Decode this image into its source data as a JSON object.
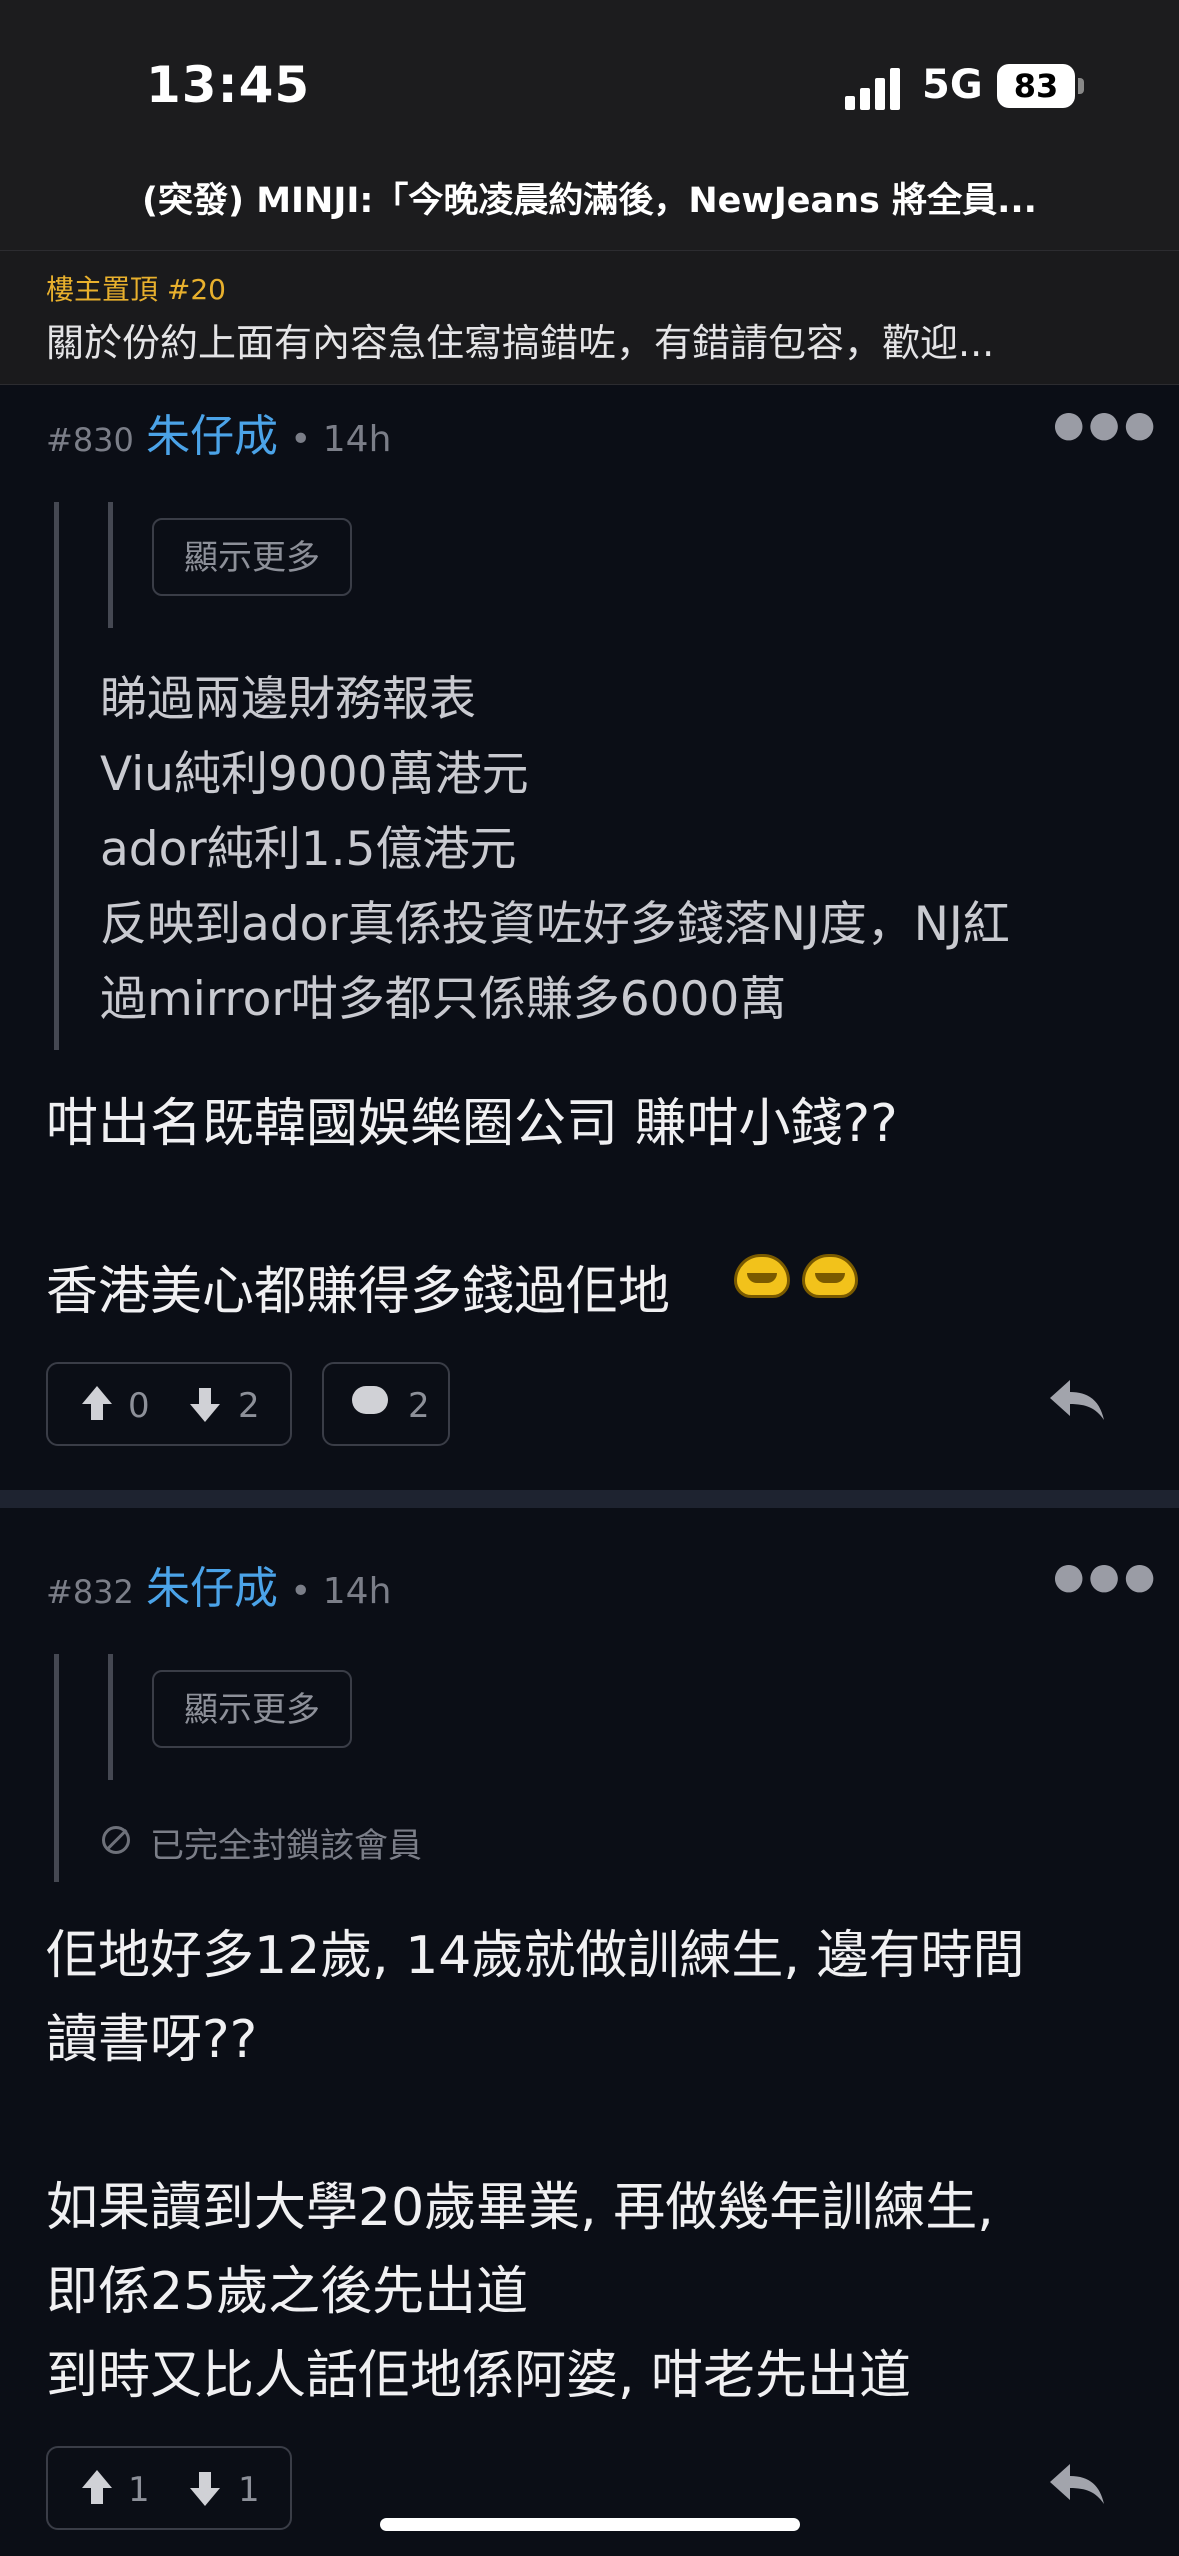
{
  "status_bar": {
    "time": "13:45",
    "network": "5G",
    "battery": "83"
  },
  "header": {
    "thread_title": "(突發) MINJI:「今晚凌晨約滿後，NewJeans 將全員..."
  },
  "pinned": {
    "label": "樓主置頂 #20",
    "text": "關於份約上面有內容急住寫搞錯咗，有錯請包容，歡迎..."
  },
  "posts": [
    {
      "number": "#830",
      "author": "朱仔成",
      "time": "• 14h",
      "show_more": "顯示更多",
      "quote_lines": [
        "睇過兩邊財務報表",
        "Viu純利9000萬港元",
        "ador純利1.5億港元",
        "反映到ador真係投資咗好多錢落NJ度，NJ紅",
        "過mirror咁多都只係賺多6000萬"
      ],
      "body_lines": [
        "咁出名既韓國娛樂圈公司 賺咁小錢??",
        "",
        "香港美心都賺得多錢過佢地"
      ],
      "upvotes": "0",
      "downvotes": "2",
      "comments": "2"
    },
    {
      "number": "#832",
      "author": "朱仔成",
      "time": "• 14h",
      "show_more": "顯示更多",
      "blocked_note": "已完全封鎖該會員",
      "body_lines": [
        "佢地好多12歲, 14歲就做訓練生, 邊有時間",
        "讀書呀??",
        "",
        "如果讀到大學20歲畢業, 再做幾年訓練生,",
        "即係25歲之後先出道",
        "到時又比人話佢地係阿婆, 咁老先出道"
      ],
      "upvotes": "1",
      "downvotes": "1"
    }
  ]
}
